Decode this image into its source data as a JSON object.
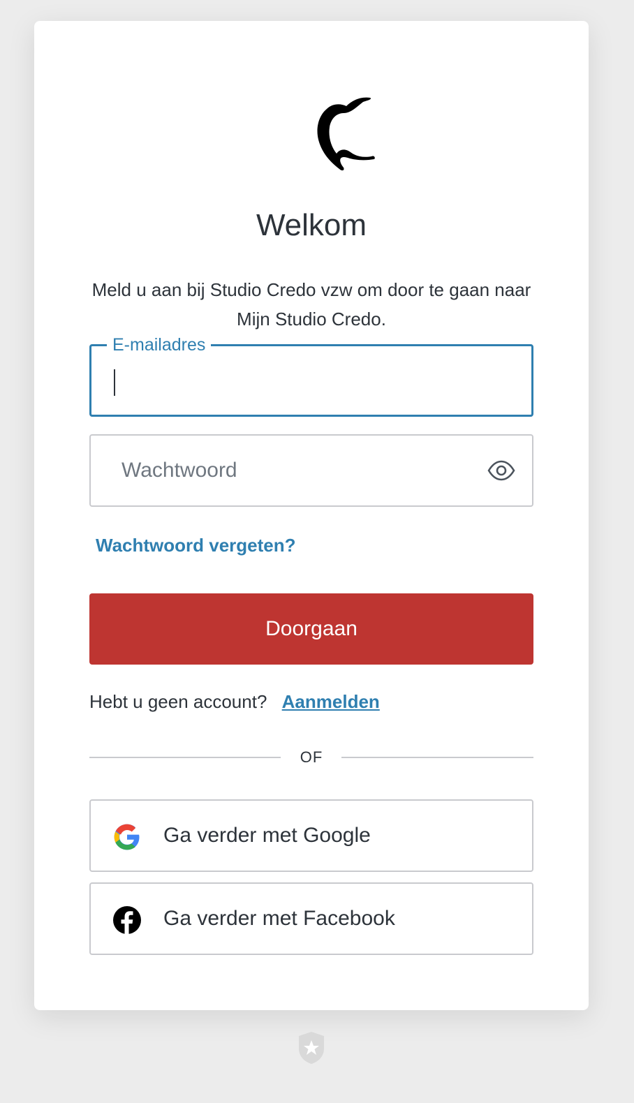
{
  "login": {
    "title": "Welkom",
    "subtitle": "Meld u aan bij Studio Credo vzw om door te gaan naar Mijn Studio Credo.",
    "email": {
      "label": "E-mailadres",
      "value": ""
    },
    "password": {
      "placeholder": "Wachtwoord",
      "value": ""
    },
    "forgot_link": "Wachtwoord vergeten?",
    "continue_label": "Doorgaan",
    "signup_prompt": "Hebt u geen account?",
    "signup_link": "Aanmelden",
    "divider": "OF",
    "google_label": "Ga verder met Google",
    "facebook_label": "Ga verder met Facebook"
  },
  "colors": {
    "accent": "#2f7fb0",
    "primary_button": "#be3531",
    "background": "#ececec",
    "text": "#2d333a"
  },
  "icons": [
    "brand-logo",
    "eye-icon",
    "google-icon",
    "facebook-icon",
    "auth-badge-icon"
  ]
}
